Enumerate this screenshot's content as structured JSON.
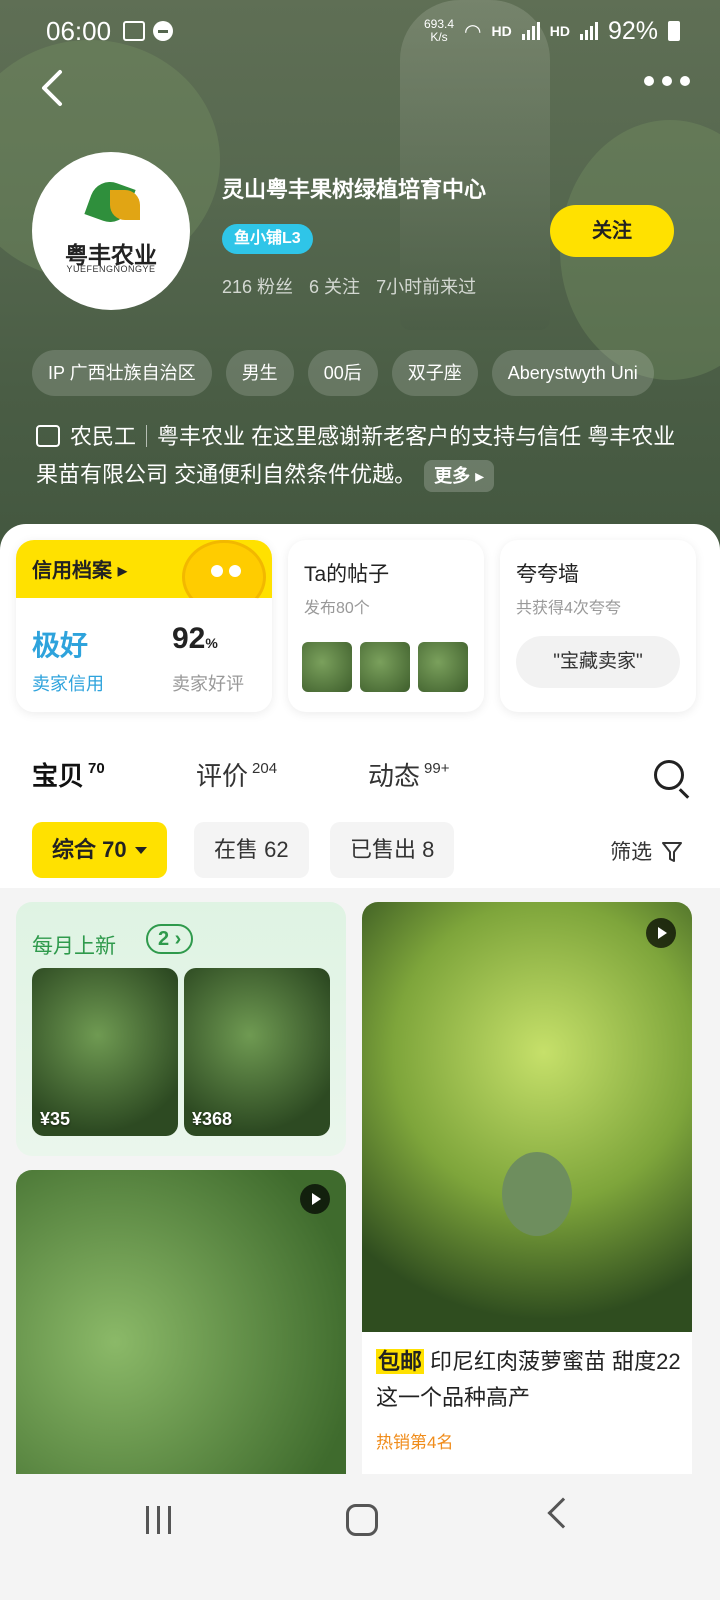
{
  "status_bar": {
    "time": "06:00",
    "net_speed": "693.4",
    "net_unit": "K/s",
    "hd1": "HD",
    "hd2": "HD",
    "battery": "92%"
  },
  "shop": {
    "logo_text": "粤丰农业",
    "logo_subtext": "YUEFENGNONGYE",
    "name": "灵山粤丰果树绿植培育中心",
    "badge": "鱼小铺L3",
    "follow_label": "关注",
    "fans": "216 粉丝",
    "following": "6 关注",
    "last_seen": "7小时前来过"
  },
  "tags": [
    "IP 广西壮族自治区",
    "男生",
    "00后",
    "双子座",
    "Aberystwyth Uni"
  ],
  "bio": {
    "role": "农民工",
    "text": "粤丰农业 在这里感谢新老客户的支持与信任 粤丰农业果苗有限公司 交通便利自然条件优越。",
    "more": "更多"
  },
  "cards": {
    "credit": {
      "title": "信用档案",
      "rating": "极好",
      "rating_label": "卖家信用",
      "good_rate": "92",
      "good_rate_unit": "%",
      "good_rate_label": "卖家好评"
    },
    "posts": {
      "title": "Ta的帖子",
      "subtitle": "发布80个"
    },
    "praise": {
      "title": "夸夸墙",
      "subtitle": "共获得4次夸夸",
      "pill": "\"宝藏卖家\""
    }
  },
  "tabs": [
    {
      "label": "宝贝",
      "count": "70"
    },
    {
      "label": "评价",
      "count": "204"
    },
    {
      "label": "动态",
      "count": "99+"
    }
  ],
  "filters": {
    "chips": [
      "综合 70",
      "在售 62",
      "已售出 8"
    ],
    "filter_label": "筛选"
  },
  "monthly": {
    "title": "每月上新",
    "count": "2",
    "prices": [
      "¥35",
      "¥368"
    ]
  },
  "product_right": {
    "tag": "包邮",
    "title": "印尼红肉菠萝蜜苗 甜度22 这一个品种高产",
    "rank": "热销第4名"
  },
  "colors": {
    "accent": "#ffe100",
    "credit_blue": "#2ea3dc",
    "green": "#2f9a4c",
    "hot": "#f08c1a"
  }
}
